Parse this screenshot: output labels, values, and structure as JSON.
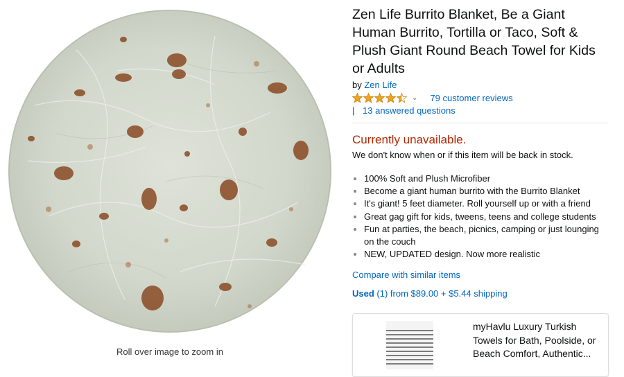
{
  "image": {
    "zoom_hint": "Roll over image to zoom in"
  },
  "product": {
    "title": "Zen Life Burrito Blanket, Be a Giant Human Burrito, Tortilla or Taco, Soft & Plush Giant Round Beach Towel for Kids or Adults",
    "by_prefix": "by",
    "brand": "Zen Life",
    "rating": 4.5,
    "reviews_link": "79 customer reviews",
    "qa_separator": "|",
    "qa_link": "13 answered questions",
    "availability": "Currently unavailable.",
    "stock_note": "We don't know when or if this item will be back in stock.",
    "bullets": [
      "100% Soft and Plush Microfiber",
      "Become a giant human burrito with the Burrito Blanket",
      "It's giant! 5 feet diameter. Roll yourself up or with a friend",
      "Great gag gift for kids, tweens, teens and college students",
      "Fun at parties, the beach, picnics, camping or just lounging on the couch",
      "NEW, UPDATED design. Now more realistic"
    ],
    "compare_link": "Compare with similar items",
    "used_label": "Used",
    "used_rest": " (1) from $89.00 + $5.44 shipping"
  },
  "sponsored": {
    "title": "myHavlu Luxury Turkish Towels for Bath, Poolside, or Beach Comfort, Authentic..."
  },
  "colors": {
    "link": "#0066c0",
    "unavailable": "#b12704",
    "star": "#f0a41c"
  },
  "icons": {
    "rating": "star-icon",
    "dropdown": "chevron-down-icon"
  }
}
